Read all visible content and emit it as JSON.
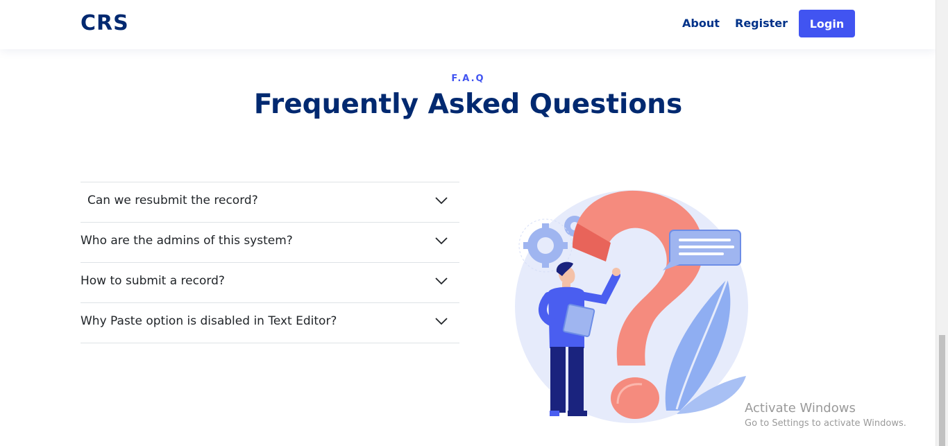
{
  "header": {
    "logo": "CRS",
    "nav": {
      "about": "About",
      "register": "Register",
      "login": "Login"
    }
  },
  "faq": {
    "subtitle": "F.A.Q",
    "title": "Frequently Asked Questions",
    "questions": [
      "Can we resubmit the record?",
      "Who are the admins of this system?",
      "How to submit a record?",
      "Why Paste option is disabled in Text Editor?"
    ]
  },
  "watermark": {
    "title": "Activate Windows",
    "subtitle": "Go to Settings to activate Windows."
  },
  "colors": {
    "brand": "#012970",
    "accent": "#4154f1",
    "question_mark": "#f58b7e"
  },
  "icons": {
    "accordion": "chevron-down-icon"
  }
}
